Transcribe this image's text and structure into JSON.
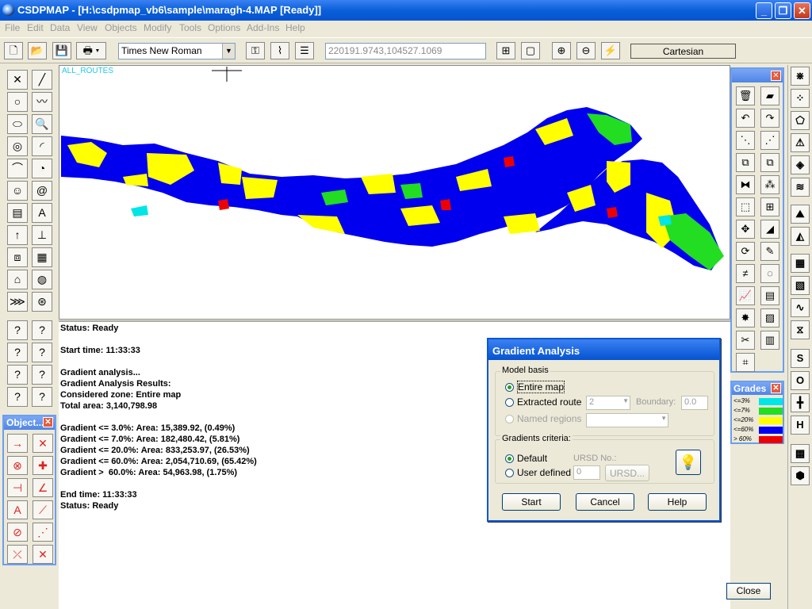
{
  "window": {
    "title": "CSDPMAP - [H:\\csdpmap_vb6\\sample\\maragh-4.MAP [Ready]]"
  },
  "menu": [
    "File",
    "Edit",
    "Data",
    "View",
    "Objects",
    "Modify",
    "Tools",
    "Options",
    "Add-Ins",
    "Help"
  ],
  "toolbar": {
    "font": "Times New Roman",
    "coordinates": "220191.9743,104527.1069",
    "projection": "Cartesian"
  },
  "map": {
    "label": "ALL_ROUTES",
    "colors": {
      "blue": "#0000ee",
      "yellow": "#ffff00",
      "green": "#22dd22",
      "red": "#ee0000",
      "cyan": "#00e5e5"
    }
  },
  "log": [
    "Status: Ready",
    "",
    "Start time: 11:33:33",
    "",
    "Gradient analysis...",
    "Gradient Analysis Results:",
    "Considered zone: Entire map",
    "Total area: 3,140,798.98",
    "",
    "Gradient <= 3.0%: Area: 15,389.92, (0.49%)",
    "Gradient <= 7.0%: Area: 182,480.42, (5.81%)",
    "Gradient <= 20.0%: Area: 833,253.97, (26.53%)",
    "Gradient <= 60.0%: Area: 2,054,710.69, (65.42%)",
    "Gradient >  60.0%: Area: 54,963.98, (1.75%)",
    "",
    "End time: 11:33:33",
    "Status: Ready"
  ],
  "objects_panel": {
    "title": "Object..."
  },
  "grades": {
    "title": "Grades",
    "rows": [
      {
        "label": "<=3%",
        "color": "#00e5e5"
      },
      {
        "label": "<=7%",
        "color": "#22dd22"
      },
      {
        "label": "<=20%",
        "color": "#ffff00"
      },
      {
        "label": "<=60%",
        "color": "#0000ee"
      },
      {
        "label": "> 60%",
        "color": "#ee0000"
      }
    ]
  },
  "dialog": {
    "title": "Gradient Analysis",
    "model_basis": "Model basis",
    "opt_entire": "Entire map",
    "opt_route": "Extracted route",
    "route_value": "2",
    "boundary_label": "Boundary:",
    "boundary_value": "0.0",
    "opt_named": "Named regions",
    "criteria": "Gradients criteria:",
    "opt_default": "Default",
    "opt_user": "User defined",
    "ursd_label": "URSD No.:",
    "ursd_value": "0",
    "ursd_button": "URSD...",
    "start": "Start",
    "cancel": "Cancel",
    "help": "Help"
  },
  "close_button": "Close",
  "far_right_letters": [
    "S",
    "O",
    "H"
  ]
}
